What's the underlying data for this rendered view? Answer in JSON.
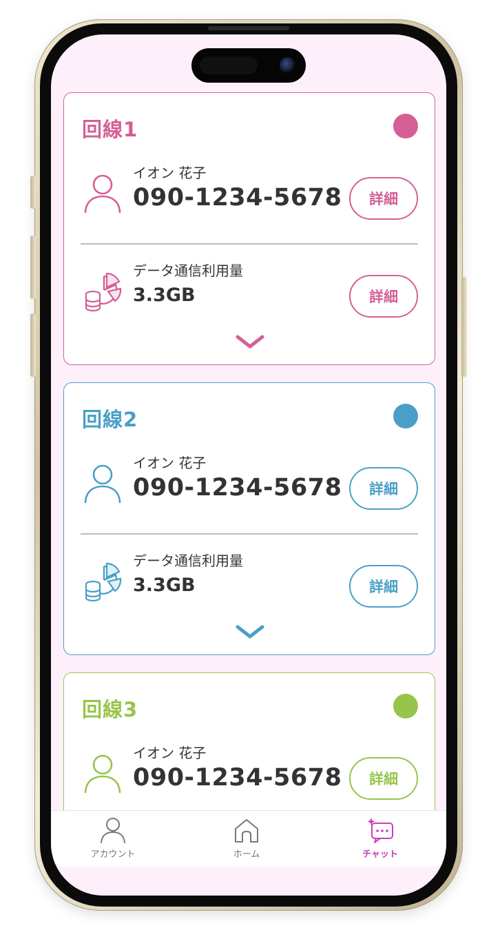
{
  "colors": {
    "line1": "#d45f96",
    "line2": "#4a9fc7",
    "line3": "#97c44c",
    "chat_active": "#c93fb8",
    "text_dark": "#333333",
    "screen_bg": "#fdf0fb"
  },
  "lines": [
    {
      "title": "回線1",
      "user_name": "イオン 花子",
      "phone_number": "090-1234-5678",
      "detail_label": "詳細",
      "data_label": "データ通信利用量",
      "data_usage": "3.3GB"
    },
    {
      "title": "回線2",
      "user_name": "イオン 花子",
      "phone_number": "090-1234-5678",
      "detail_label": "詳細",
      "data_label": "データ通信利用量",
      "data_usage": "3.3GB"
    },
    {
      "title": "回線3",
      "user_name": "イオン 花子",
      "phone_number": "090-1234-5678",
      "detail_label": "詳細"
    }
  ],
  "icons": {
    "user": "person-icon",
    "data": "pie-chart-coins-icon",
    "expand": "chevron-down-icon",
    "account": "person-icon",
    "home": "house-icon",
    "chat": "chat-sparkle-icon"
  },
  "tabs": {
    "account": "アカウント",
    "home": "ホーム",
    "chat": "チャット",
    "active": "chat"
  }
}
